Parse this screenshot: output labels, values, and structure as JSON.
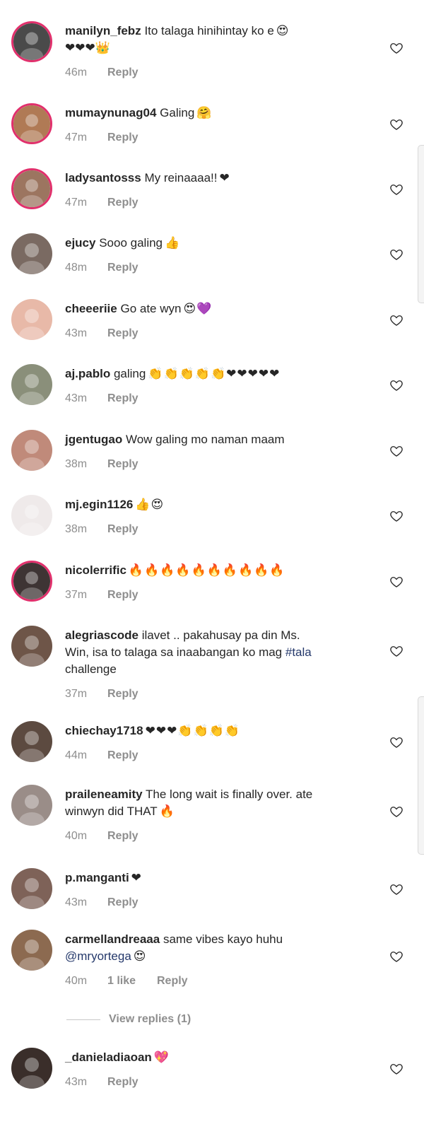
{
  "colors": {
    "text": "#262626",
    "muted": "#8e8e8e",
    "ring": "#e1306c",
    "link": "#25396b"
  },
  "comments": [
    {
      "user": "manilyn_febz",
      "text": "Ito talaga hinihintay ko e",
      "emoji": "😍",
      "line2": "❤❤❤👑",
      "time": "46m",
      "likes": "",
      "reply": "Reply",
      "ring": true,
      "avatar_color": "#4a4a4a"
    },
    {
      "user": "mumaynunag04",
      "text": "Galing",
      "emoji": "🤗",
      "line2": "",
      "time": "47m",
      "likes": "",
      "reply": "Reply",
      "ring": true,
      "avatar_color": "#b07a55"
    },
    {
      "user": "ladysantosss",
      "text": "My reinaaaa!!",
      "emoji": "❤",
      "line2": "",
      "time": "47m",
      "likes": "",
      "reply": "Reply",
      "ring": true,
      "avatar_color": "#9c7560"
    },
    {
      "user": "ejucy",
      "text": "Sooo galing",
      "emoji": "👍",
      "line2": "",
      "time": "48m",
      "likes": "",
      "reply": "Reply",
      "ring": false,
      "avatar_color": "#7a6a62"
    },
    {
      "user": "cheeeriie",
      "text": "Go ate wyn",
      "emoji": "😍💜",
      "line2": "",
      "time": "43m",
      "likes": "",
      "reply": "Reply",
      "ring": false,
      "avatar_color": "#e8b9a8"
    },
    {
      "user": "aj.pablo",
      "text": "galing",
      "emoji": "👏👏👏👏👏❤❤❤❤❤",
      "line2": "",
      "time": "43m",
      "likes": "",
      "reply": "Reply",
      "ring": false,
      "avatar_color": "#8a8f7a"
    },
    {
      "user": "jgentugao",
      "text": "Wow galing mo naman maam",
      "emoji": "",
      "line2": "",
      "time": "38m",
      "likes": "",
      "reply": "Reply",
      "ring": false,
      "avatar_color": "#c08a7a"
    },
    {
      "user": "mj.egin1126",
      "text": "",
      "emoji": "👍😍",
      "line2": "",
      "time": "38m",
      "likes": "",
      "reply": "Reply",
      "ring": false,
      "avatar_color": "#efeaea"
    },
    {
      "user": "nicolerrific",
      "text": "",
      "emoji": "🔥🔥🔥🔥🔥🔥🔥🔥🔥🔥",
      "line2": "",
      "time": "37m",
      "likes": "",
      "reply": "Reply",
      "ring": true,
      "avatar_color": "#3e3434"
    },
    {
      "user": "alegriascode",
      "text": "ilavet .. pakahusay pa din Ms.",
      "emoji": "",
      "line2": "Win, isa to talaga sa inaabangan ko mag",
      "line2_link": "#tala",
      "line3": "challenge",
      "time": "37m",
      "likes": "",
      "reply": "Reply",
      "ring": false,
      "avatar_color": "#6e5548"
    },
    {
      "user": "chiechay1718",
      "text": "",
      "emoji": "❤❤❤👏👏👏👏",
      "line2": "",
      "time": "44m",
      "likes": "",
      "reply": "Reply",
      "ring": false,
      "avatar_color": "#5c4a40"
    },
    {
      "user": "praileneamity",
      "text": "The long wait is finally over. ate",
      "emoji": "",
      "line2": "winwyn did THAT",
      "line2_emoji": "🔥",
      "time": "40m",
      "likes": "",
      "reply": "Reply",
      "ring": false,
      "avatar_color": "#9a8d88"
    },
    {
      "user": "p.manganti",
      "text": "",
      "emoji": "❤",
      "line2": "",
      "time": "43m",
      "likes": "",
      "reply": "Reply",
      "ring": false,
      "avatar_color": "#7e6258"
    },
    {
      "user": "carmellandreaaa",
      "text": "same vibes kayo huhu",
      "emoji": "",
      "line2": "",
      "line2_link": "@mryortega",
      "line2_emoji": "😍",
      "time": "40m",
      "likes": "1 like",
      "reply": "Reply",
      "ring": false,
      "avatar_color": "#8c6a50"
    },
    {
      "user": "_danieladiaoan",
      "text": "",
      "emoji": "💖",
      "line2": "",
      "time": "43m",
      "likes": "",
      "reply": "Reply",
      "ring": false,
      "avatar_color": "#3a2e2a"
    }
  ],
  "view_replies": "View replies (1)"
}
